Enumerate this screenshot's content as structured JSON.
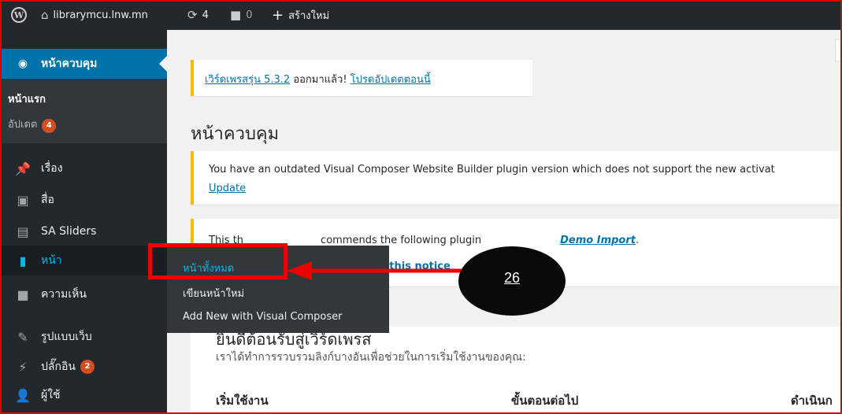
{
  "adminbar": {
    "site_name": "librarymcu.lnw.mn",
    "updates_count": "4",
    "comments_count": "0",
    "new_label": "สร้างใหม่"
  },
  "sidebar": {
    "dashboard": "หน้าควบคุม",
    "home": "หน้าแรก",
    "updates": "อัปเดต",
    "updates_badge": "4",
    "posts": "เรื่อง",
    "media": "สื่อ",
    "sa_sliders": "SA Sliders",
    "pages": "หน้า",
    "comments": "ความเห็น",
    "appearance": "รูปแบบเว็บ",
    "plugins": "ปลั๊กอิน",
    "plugins_badge": "2",
    "users": "ผู้ใช้"
  },
  "flyout": {
    "all_pages": "หน้าทั้งหมด",
    "add_new": "เขียนหน้าใหม่",
    "add_new_vc": "Add New with Visual Composer"
  },
  "main": {
    "update_notice_link": "เวิร์ดเพรสรุ่น 5.3.2",
    "update_notice_text": " ออกมาแล้ว! ",
    "update_notice_action": "โปรดอัปเดตตอนนี้",
    "page_title": "หน้าควบคุม",
    "vc_notice": "You have an outdated Visual Composer Website Builder plugin version which does not support the new activat",
    "vc_update": "Update",
    "theme_notice_a": "This th",
    "theme_notice_b": "commends the following plugin",
    "theme_notice_link": "Demo Import",
    "theme_dismiss": "s this notice",
    "welcome_title": "ยินดีต้อนรับสู่เวิร์ดเพรส",
    "welcome_sub": "เราได้ทำการรวบรวมลิงก์บางอันเพื่อช่วยในการเริ่มใช้งานของคุณ:",
    "col1": "เริ่มใช้งาน",
    "col2": "ขั้นตอนต่อไป",
    "col3": "ดำเนินก"
  },
  "annotation": {
    "step_number": "26"
  },
  "colors": {
    "admin_dark": "#23282d",
    "accent": "#0073aa",
    "highlight_red": "#e00000",
    "badge": "#d54e21"
  }
}
